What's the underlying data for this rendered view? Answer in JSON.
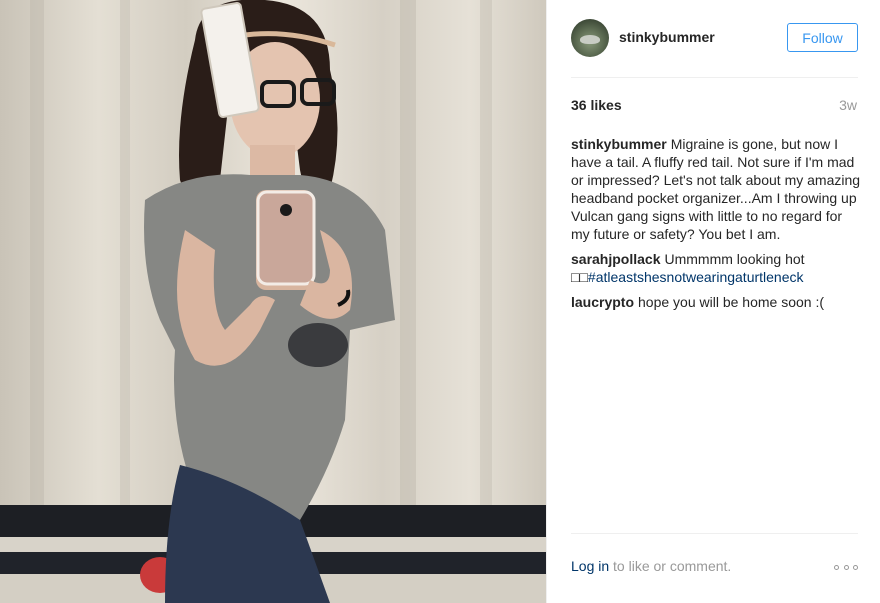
{
  "post": {
    "username": "stinkybummer",
    "follow_label": "Follow",
    "likes": "36 likes",
    "timestamp": "3w",
    "caption": "Migraine is gone, but now I have a tail. A fluffy red tail. Not sure if I'm mad or impressed? Let's not talk about my amazing headband pocket organizer...Am I throwing up Vulcan gang signs with little to no regard for my future or safety? You bet I am."
  },
  "comments": [
    {
      "author": "sarahjpollack",
      "text": "Ummmmm looking hot □□",
      "hashtag": "#atleastshesnotwearingaturtleneck"
    },
    {
      "author": "laucrypto",
      "text": "hope you will be home soon :("
    }
  ],
  "footer": {
    "login_link": "Log in",
    "login_suffix": " to like or comment."
  },
  "icons": {
    "options": "more-options-icon"
  },
  "colors": {
    "link": "#3897f0",
    "hashtag": "#003569",
    "muted": "#999999"
  }
}
